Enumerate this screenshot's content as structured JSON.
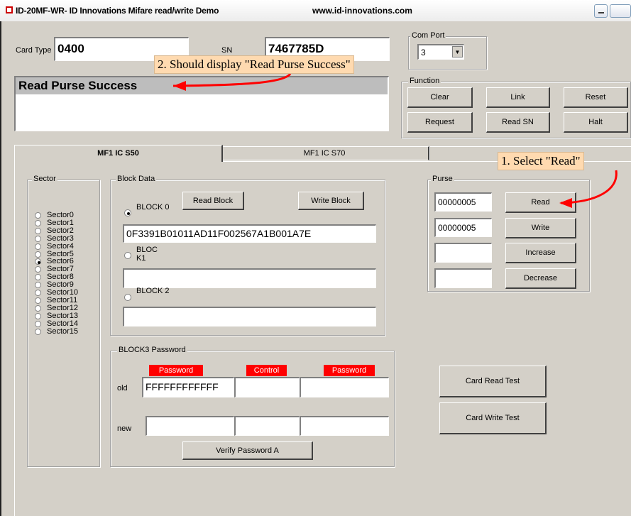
{
  "window": {
    "title": "ID-20MF-WR- ID Innovations Mifare read/write Demo",
    "url": "www.id-innovations.com"
  },
  "card": {
    "type_label": "Card Type",
    "type_value": "0400",
    "sn_label": "SN",
    "sn_value": "7467785D"
  },
  "com_port": {
    "legend": "Com Port",
    "value": "3"
  },
  "status": {
    "message": "Read Purse Success"
  },
  "function": {
    "legend": "Function",
    "clear": "Clear",
    "link": "Link",
    "reset": "Reset",
    "request": "Request",
    "read_sn": "Read SN",
    "halt": "Halt"
  },
  "tabs": {
    "s50": "MF1 IC S50",
    "s70": "MF1 IC S70"
  },
  "sector": {
    "legend": "Sector",
    "items": [
      "Sector0",
      "Sector1",
      "Sector2",
      "Sector3",
      "Sector4",
      "Sector5",
      "Sector6",
      "Sector7",
      "Sector8",
      "Sector9",
      "Sector10",
      "Sector11",
      "Sector12",
      "Sector13",
      "Sector14",
      "Sector15"
    ],
    "selected": "Sector6"
  },
  "block_data": {
    "legend": "Block Data",
    "read_block": "Read Block",
    "write_block": "Write Block",
    "block0_label": "BLOCK 0",
    "block0_value": "0F3391B01011AD11F002567A1B001A7E",
    "block1_label": "BLOC K1",
    "block1_value": "",
    "block2_label": "BLOCK 2",
    "block2_value": ""
  },
  "purse": {
    "legend": "Purse",
    "value1": "00000005",
    "value2": "00000005",
    "value3": "",
    "value4": "",
    "read": "Read",
    "write": "Write",
    "increase": "Increase",
    "decrease": "Decrease"
  },
  "password": {
    "legend": "BLOCK3 Password",
    "col_password_a": "Password",
    "col_control": "Control",
    "col_password_b": "Password",
    "old_label": "old",
    "old_value": "FFFFFFFFFFFF",
    "new_label": "new",
    "verify": "Verify Password A"
  },
  "tests": {
    "read": "Card Read Test",
    "write": "Card Write Test"
  },
  "annotations": {
    "step1": "1. Select \"Read\"",
    "step2": "2. Should display \"Read Purse Success\"",
    "color": "#ff0000"
  }
}
